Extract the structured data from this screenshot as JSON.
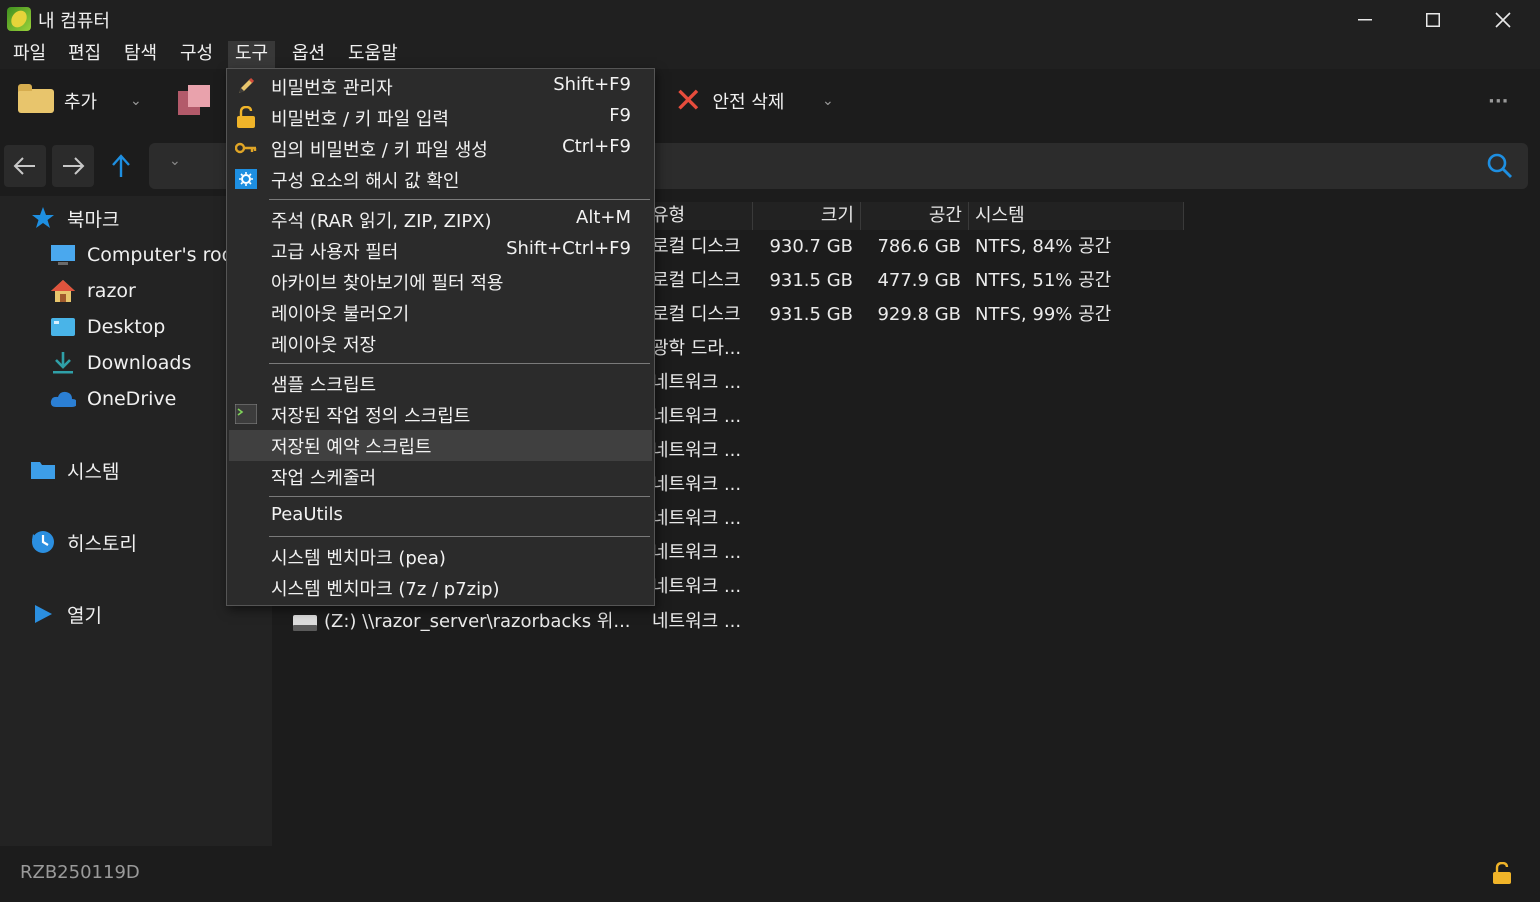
{
  "window": {
    "title": "내 컴퓨터"
  },
  "menubar": {
    "items": [
      "파일",
      "편집",
      "탐색",
      "구성",
      "도구",
      "옵션",
      "도움말"
    ],
    "active": "도구"
  },
  "toolbar": {
    "add_label": "추가",
    "extract_label_partial": "ⅼ",
    "secure_delete_label": "안전 삭제",
    "more_label": "···"
  },
  "sidebar": {
    "bookmarks_label": "북마크",
    "bookmark_items": [
      "Computer's roo",
      "razor",
      "Desktop",
      "Downloads",
      "OneDrive"
    ],
    "system_label": "시스템",
    "history_label": "히스토리",
    "open_label": "열기"
  },
  "columns": {
    "type": "유형",
    "size": "크기",
    "free": "공간",
    "fs": "시스템"
  },
  "rows": [
    {
      "type": "로컬 디스크",
      "size": "930.7 GB",
      "free": "786.6 GB",
      "fs": "NTFS, 84% 공간"
    },
    {
      "type": "로컬 디스크",
      "size": "931.5 GB",
      "free": "477.9 GB",
      "fs": "NTFS, 51% 공간"
    },
    {
      "type": "로컬 디스크",
      "size": "931.5 GB",
      "free": "929.8 GB",
      "fs": "NTFS, 99% 공간"
    },
    {
      "type": "광학 드라...",
      "size": "",
      "free": "",
      "fs": ""
    },
    {
      "type": "네트워크 ...",
      "size": "",
      "free": "",
      "fs": ""
    },
    {
      "type": "네트워크 ...",
      "size": "",
      "free": "",
      "fs": ""
    },
    {
      "type": "네트워크 ...",
      "size": "",
      "free": "",
      "fs": ""
    },
    {
      "type": "네트워크 ...",
      "size": "",
      "free": "",
      "fs": ""
    },
    {
      "type": "네트워크 ...",
      "size": "",
      "free": "",
      "fs": ""
    },
    {
      "type": "네트워크 ...",
      "size": "",
      "free": "",
      "fs": ""
    },
    {
      "type": "네트워크 ...",
      "size": "",
      "free": "",
      "fs": ""
    },
    {
      "type": "네트워크 ...",
      "size": "",
      "free": "",
      "fs": ""
    }
  ],
  "last_row_name": "(Z:) \\\\razor_server\\razorbacks 위...",
  "tools_menu": [
    {
      "label": "비밀번호 관리자",
      "shortcut": "Shift+F9",
      "icon": "pencil-icon"
    },
    {
      "label": "비밀번호 / 키 파일 입력",
      "shortcut": "F9",
      "icon": "padlock-icon"
    },
    {
      "label": "임의 비밀번호 / 키 파일 생성",
      "shortcut": "Ctrl+F9",
      "icon": "key-icon"
    },
    {
      "label": "구성 요소의 해시 값 확인",
      "shortcut": "",
      "icon": "gear-icon"
    },
    {
      "label": "주석 (RAR 읽기, ZIP, ZIPX)",
      "shortcut": "Alt+M",
      "icon": ""
    },
    {
      "label": "고급 사용자 필터",
      "shortcut": "Shift+Ctrl+F9",
      "icon": ""
    },
    {
      "label": "아카이브 찾아보기에 필터 적용",
      "shortcut": "",
      "icon": ""
    },
    {
      "label": "레이아웃 불러오기",
      "shortcut": "",
      "icon": ""
    },
    {
      "label": "레이아웃 저장",
      "shortcut": "",
      "icon": ""
    },
    {
      "label": "샘플 스크립트",
      "shortcut": "",
      "icon": ""
    },
    {
      "label": "저장된 작업 정의 스크립트",
      "shortcut": "",
      "icon": "terminal-icon"
    },
    {
      "label": "저장된 예약 스크립트",
      "shortcut": "",
      "icon": ""
    },
    {
      "label": "작업 스케줄러",
      "shortcut": "",
      "icon": ""
    },
    {
      "label": "PeaUtils",
      "shortcut": "",
      "icon": ""
    },
    {
      "label": "시스템 벤치마크 (pea)",
      "shortcut": "",
      "icon": ""
    },
    {
      "label": "시스템 벤치마크 (7z / p7zip)",
      "shortcut": "",
      "icon": ""
    }
  ],
  "highlighted_menu_item": "저장된 예약 스크립트",
  "status": {
    "build": "RZB250119D"
  },
  "colors": {
    "accent": "#1e8fe1",
    "delete": "#e74c3c",
    "folder": "#e8c56c",
    "lock": "#f0b429"
  }
}
